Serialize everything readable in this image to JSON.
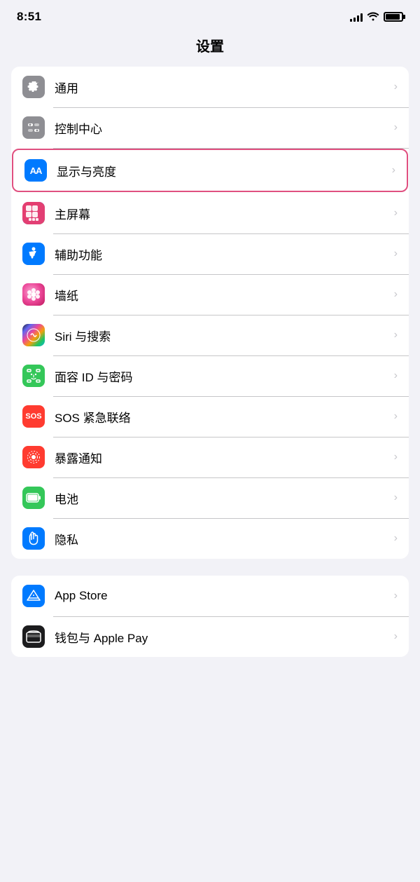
{
  "statusBar": {
    "time": "8:51",
    "signalBars": [
      4,
      6,
      8,
      10,
      12
    ],
    "batteryLevel": 90
  },
  "pageTitle": "设置",
  "group1": {
    "items": [
      {
        "id": "general",
        "label": "通用",
        "iconType": "gear",
        "iconBg": "gray"
      },
      {
        "id": "control-center",
        "label": "控制中心",
        "iconType": "switches",
        "iconBg": "gray"
      },
      {
        "id": "display",
        "label": "显示与亮度",
        "iconType": "aa",
        "iconBg": "blue",
        "highlighted": true
      },
      {
        "id": "home-screen",
        "label": "主屏幕",
        "iconType": "grid",
        "iconBg": "colorful"
      },
      {
        "id": "accessibility",
        "label": "辅助功能",
        "iconType": "accessibility",
        "iconBg": "blue"
      },
      {
        "id": "wallpaper",
        "label": "墙纸",
        "iconType": "flower",
        "iconBg": "pink"
      },
      {
        "id": "siri",
        "label": "Siri 与搜索",
        "iconType": "siri",
        "iconBg": "siri"
      },
      {
        "id": "faceid",
        "label": "面容 ID 与密码",
        "iconType": "faceid",
        "iconBg": "green"
      },
      {
        "id": "sos",
        "label": "SOS 紧急联络",
        "iconType": "sos",
        "iconBg": "red"
      },
      {
        "id": "exposure",
        "label": "暴露通知",
        "iconType": "exposure",
        "iconBg": "red2"
      },
      {
        "id": "battery",
        "label": "电池",
        "iconType": "battery",
        "iconBg": "green2"
      },
      {
        "id": "privacy",
        "label": "隐私",
        "iconType": "hand",
        "iconBg": "blue3"
      }
    ]
  },
  "group2": {
    "items": [
      {
        "id": "appstore",
        "label": "App Store",
        "iconType": "appstore",
        "iconBg": "appstore"
      },
      {
        "id": "wallet",
        "label": "钱包与 Apple Pay",
        "iconType": "wallet",
        "iconBg": "wallet"
      }
    ]
  },
  "chevron": "›"
}
